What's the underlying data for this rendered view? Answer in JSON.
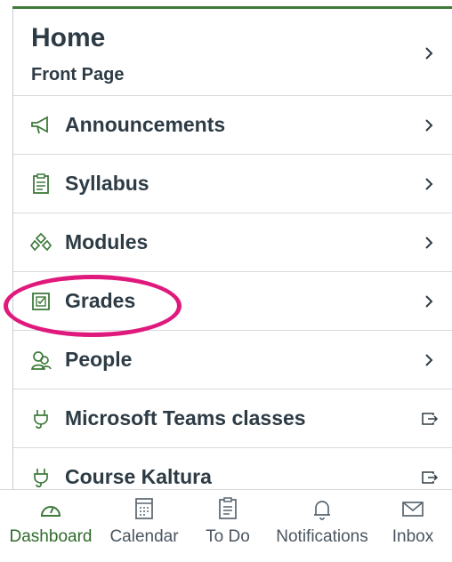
{
  "nav": {
    "home": {
      "title": "Home",
      "subtitle": "Front Page"
    },
    "items": [
      {
        "label": "Announcements",
        "icon": "megaphone-icon",
        "action": "chevron"
      },
      {
        "label": "Syllabus",
        "icon": "syllabus-icon",
        "action": "chevron"
      },
      {
        "label": "Modules",
        "icon": "modules-icon",
        "action": "chevron"
      },
      {
        "label": "Grades",
        "icon": "grades-icon",
        "action": "chevron"
      },
      {
        "label": "People",
        "icon": "people-icon",
        "action": "chevron"
      },
      {
        "label": "Microsoft Teams classes",
        "icon": "plug-icon",
        "action": "external"
      },
      {
        "label": "Course Kaltura",
        "icon": "plug-icon",
        "action": "external"
      }
    ]
  },
  "tabbar": {
    "tabs": [
      {
        "label": "Dashboard",
        "icon": "dashboard-icon",
        "active": true
      },
      {
        "label": "Calendar",
        "icon": "calendar-icon",
        "active": false
      },
      {
        "label": "To Do",
        "icon": "todo-icon",
        "active": false
      },
      {
        "label": "Notifications",
        "icon": "bell-icon",
        "active": false
      },
      {
        "label": "Inbox",
        "icon": "envelope-icon",
        "active": false
      }
    ]
  },
  "colors": {
    "accent_green": "#3e7a3a",
    "highlight": "#e0197d",
    "text": "#2d3b45"
  }
}
